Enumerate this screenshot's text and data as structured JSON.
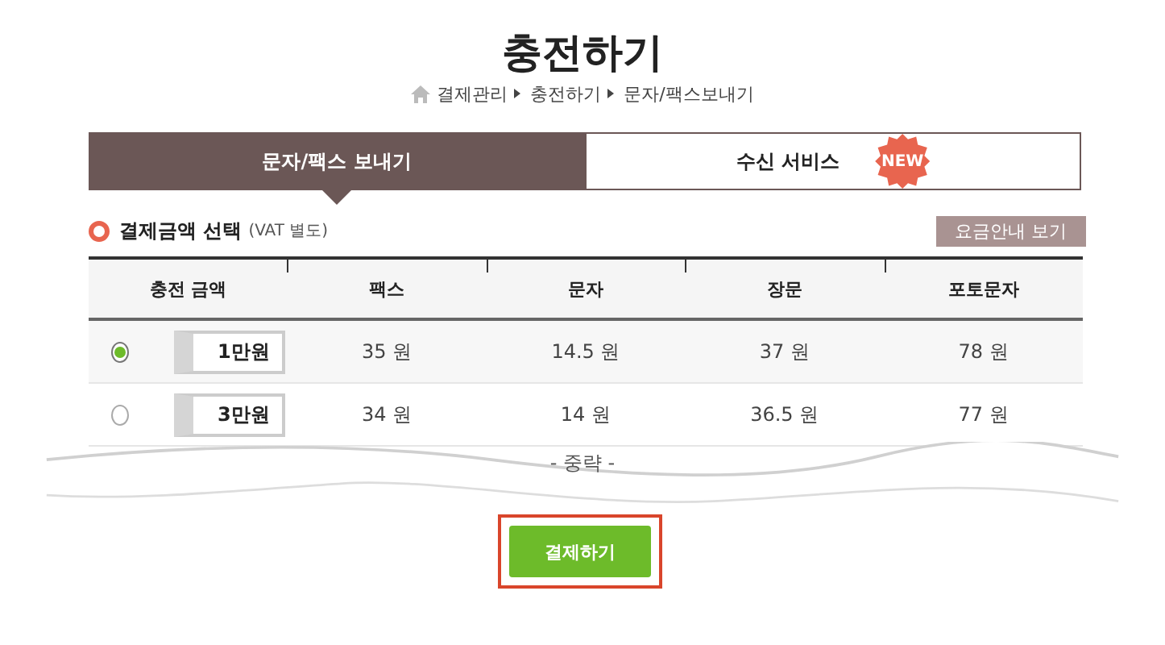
{
  "title": "충전하기",
  "breadcrumb": [
    "결제관리",
    "충전하기",
    "문자/팩스보내기"
  ],
  "tabs": [
    {
      "label": "문자/팩스 보내기",
      "selected": true
    },
    {
      "label": "수신 서비스",
      "selected": false,
      "badge": "NEW"
    }
  ],
  "section": {
    "title": "결제금액 선택",
    "note": "(VAT 별도)",
    "button": "요금안내 보기"
  },
  "table": {
    "columns": [
      "충전 금액",
      "팩스",
      "문자",
      "장문",
      "포토문자"
    ],
    "rows": [
      {
        "selected": true,
        "cells": [
          "1만원",
          "35 원",
          "14.5 원",
          "37 원",
          "78 원"
        ]
      },
      {
        "selected": false,
        "cells": [
          "3만원",
          "34 원",
          "14 원",
          "36.5 원",
          "77 원"
        ]
      }
    ]
  },
  "omitted": "- 중략 -",
  "pay_button": "결제하기"
}
